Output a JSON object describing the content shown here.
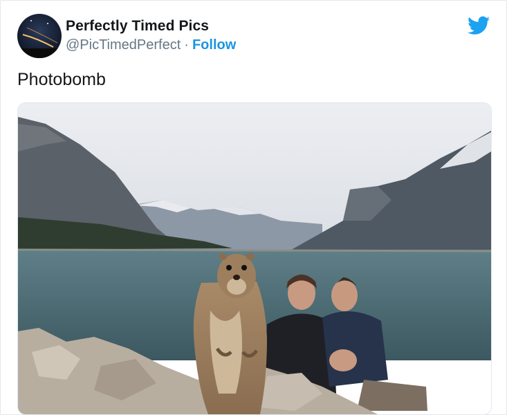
{
  "tweet": {
    "author_name": "Perfectly Timed Pics",
    "handle": "@PicTimedPerfect",
    "separator": "·",
    "follow_label": "Follow",
    "text": "Photobomb"
  },
  "icons": {
    "platform": "twitter-bird-icon",
    "avatar": "night-sky-avatar"
  },
  "colors": {
    "accent": "#1b95e0",
    "twitter_blue": "#1da1f2",
    "name": "#14171a",
    "secondary": "#657786"
  },
  "media": {
    "description_icon": "photo"
  }
}
